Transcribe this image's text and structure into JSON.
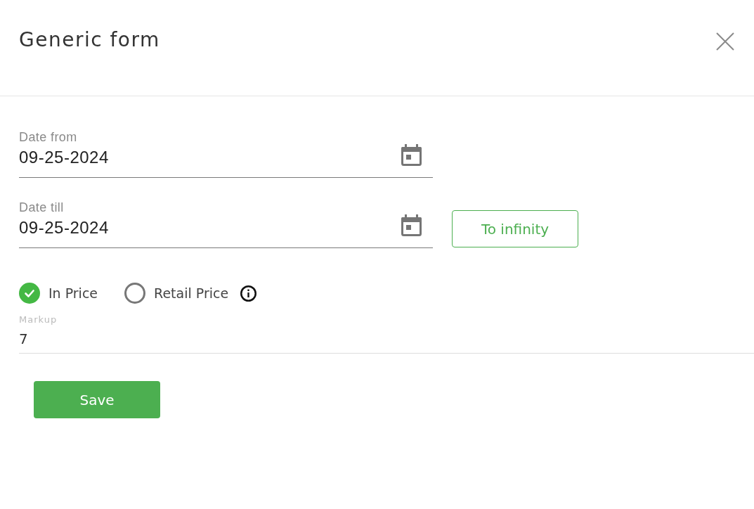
{
  "dialog": {
    "title": "Generic form"
  },
  "date_fields": [
    {
      "label": "Date from",
      "value": "09-25-2024"
    },
    {
      "label": "Date till",
      "value": "09-25-2024",
      "action": "To infinity"
    }
  ],
  "price_options": [
    {
      "label": "In Price",
      "selected": true
    },
    {
      "label": "Retail Price",
      "selected": false
    }
  ],
  "markup": {
    "label": "Markup",
    "value": "7"
  },
  "buttons": [
    "Save"
  ]
}
